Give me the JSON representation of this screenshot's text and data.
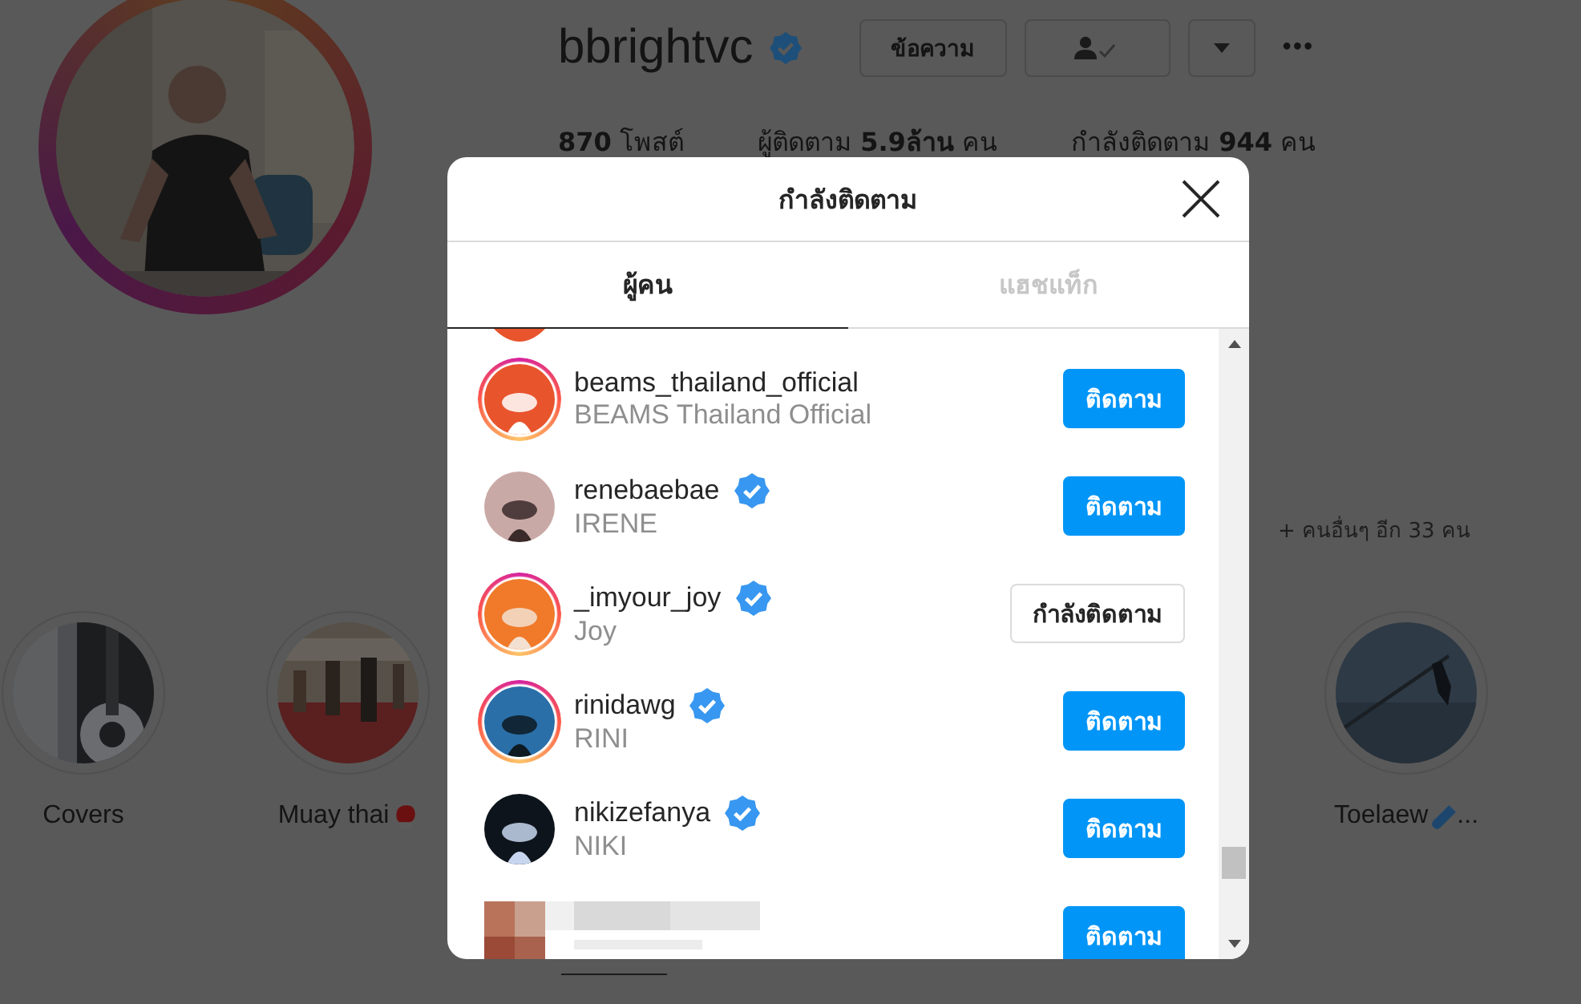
{
  "profile": {
    "username": "bbrightvc",
    "verified": true,
    "message_button": "ข้อความ",
    "more_button": "•••",
    "stats": [
      {
        "text": "**870** โพสต์"
      },
      {
        "text": "ผู้ติดตาม **5.9ล้าน** คน"
      },
      {
        "text": "กำลังติดตาม **944** คน"
      }
    ],
    "mutual_followers": "+ คนอื่นๆ อีก 33 คน"
  },
  "highlights_left": [
    {
      "title": "Covers"
    },
    {
      "title": "Muay thai"
    }
  ],
  "highlights_right": [
    {
      "title": "Toelaew",
      "ellipsis": "..."
    }
  ],
  "modal": {
    "title": "กำลังติดตาม",
    "tabs": [
      {
        "label": "ผู้คน",
        "selected": true
      },
      {
        "label": "แฮชแท็ก",
        "selected": false
      }
    ],
    "rows": [
      {
        "kind": "user",
        "username": "beams_thailand_official",
        "full_name": "BEAMS Thailand Official",
        "verified": false,
        "story_ring": true,
        "button": "ติดตาม",
        "following": false
      },
      {
        "kind": "user",
        "username": "renebaebae",
        "full_name": "IRENE",
        "verified": true,
        "story_ring": false,
        "button": "ติดตาม",
        "following": false
      },
      {
        "kind": "user",
        "username": "_imyour_joy",
        "full_name": "Joy",
        "verified": true,
        "story_ring": true,
        "button": "กำลังติดตาม",
        "following": true
      },
      {
        "kind": "user",
        "username": "rinidawg",
        "full_name": "RINI",
        "verified": true,
        "story_ring": true,
        "button": "ติดตาม",
        "following": false
      },
      {
        "kind": "user",
        "username": "nikizefanya",
        "full_name": "NIKI",
        "verified": true,
        "story_ring": false,
        "button": "ติดตาม",
        "following": false
      },
      {
        "kind": "blurred",
        "button": "ติดตาม",
        "following": false
      }
    ]
  }
}
